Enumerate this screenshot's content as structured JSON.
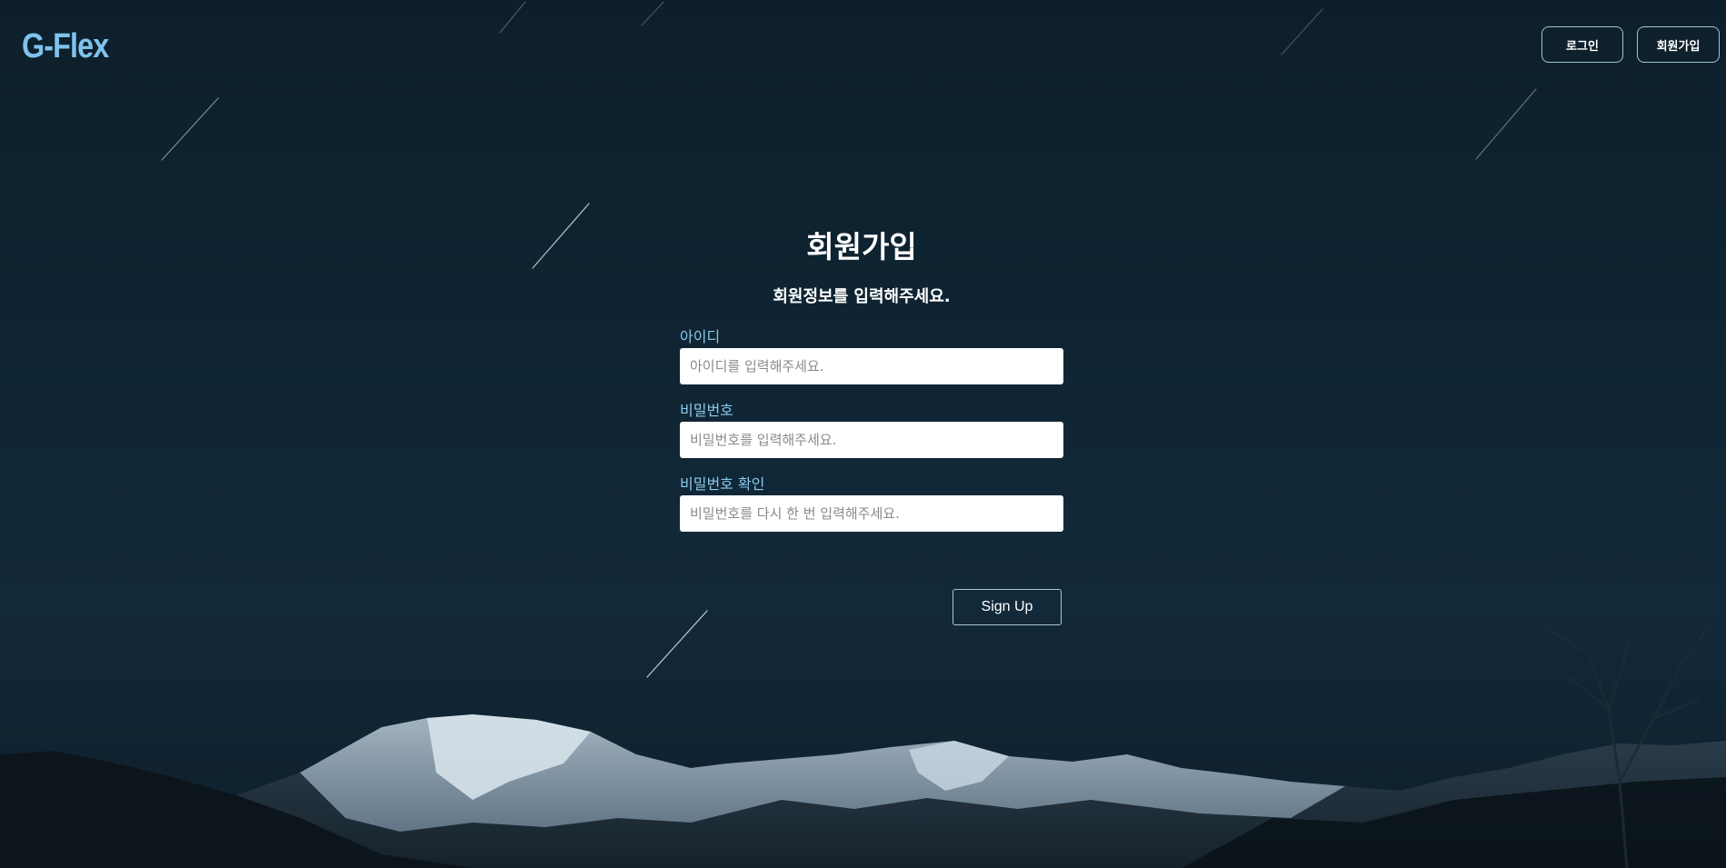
{
  "header": {
    "logo": "G-Flex",
    "login_label": "로그인",
    "signup_label": "회원가입"
  },
  "form": {
    "title": "회원가입",
    "subtitle": "회원정보를 입력해주세요.",
    "fields": [
      {
        "label": "아이디",
        "placeholder": "아이디를 입력해주세요."
      },
      {
        "label": "비밀번호",
        "placeholder": "비밀번호를 입력해주세요."
      },
      {
        "label": "비밀번호 확인",
        "placeholder": "비밀번호를 다시 한 번 입력해주세요."
      }
    ],
    "submit_label": "Sign Up"
  },
  "colors": {
    "logo": "#7ec3ec",
    "label": "#8cc8ea",
    "background": "#0f2533"
  }
}
